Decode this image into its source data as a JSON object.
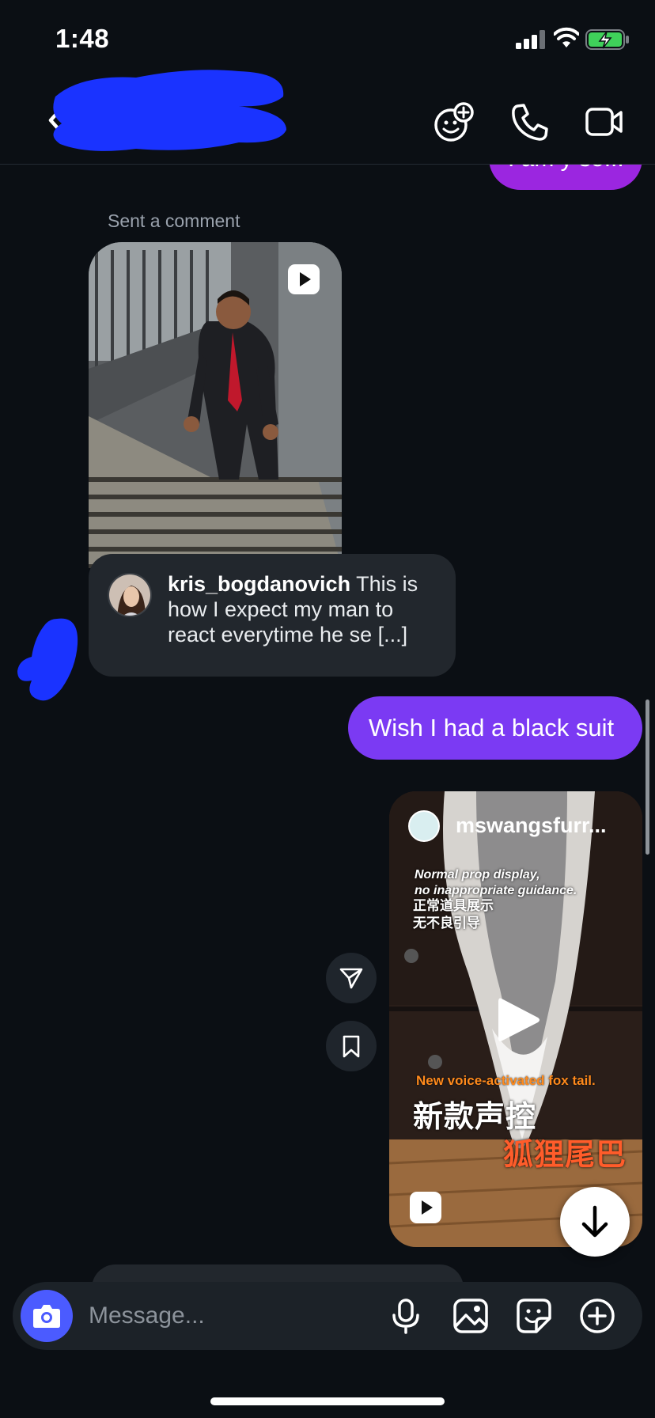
{
  "status_bar": {
    "time": "1:48"
  },
  "header": {
    "back_icon": "chevron-left-icon",
    "title": "",
    "actions": [
      "add-people-icon",
      "phone-icon",
      "video-camera-icon"
    ]
  },
  "chat": {
    "top_bubble_text": "I am y so...",
    "sent_label": "Sent a comment",
    "comment": {
      "username": "kris_bogdanovich",
      "text": "This is how I expect my man to react everytime he se [...]"
    },
    "my_message": "Wish I had a black suit",
    "shared_reel": {
      "username": "mswangsfurr...",
      "overlay_en_1": "Normal prop display,",
      "overlay_en_2": "no inappropriate guidance.",
      "overlay_cn_1": "正常道具展示",
      "overlay_cn_2": "无不良引导",
      "overlay_en_3": "New voice-activated fox tail.",
      "overlay_cn_3": "新款声控",
      "overlay_cn_4": "狐狸尾巴"
    },
    "side_actions": [
      "send-icon",
      "bookmark-icon"
    ]
  },
  "composer": {
    "placeholder": "Message...",
    "icons": [
      "camera-icon",
      "microphone-icon",
      "image-icon",
      "sticker-icon",
      "plus-circle-icon"
    ]
  },
  "colors": {
    "background": "#0b0f14",
    "sent_bubble": "#7b3af3",
    "received_bubble": "#22272d",
    "camera_button": "#4b5bff"
  }
}
